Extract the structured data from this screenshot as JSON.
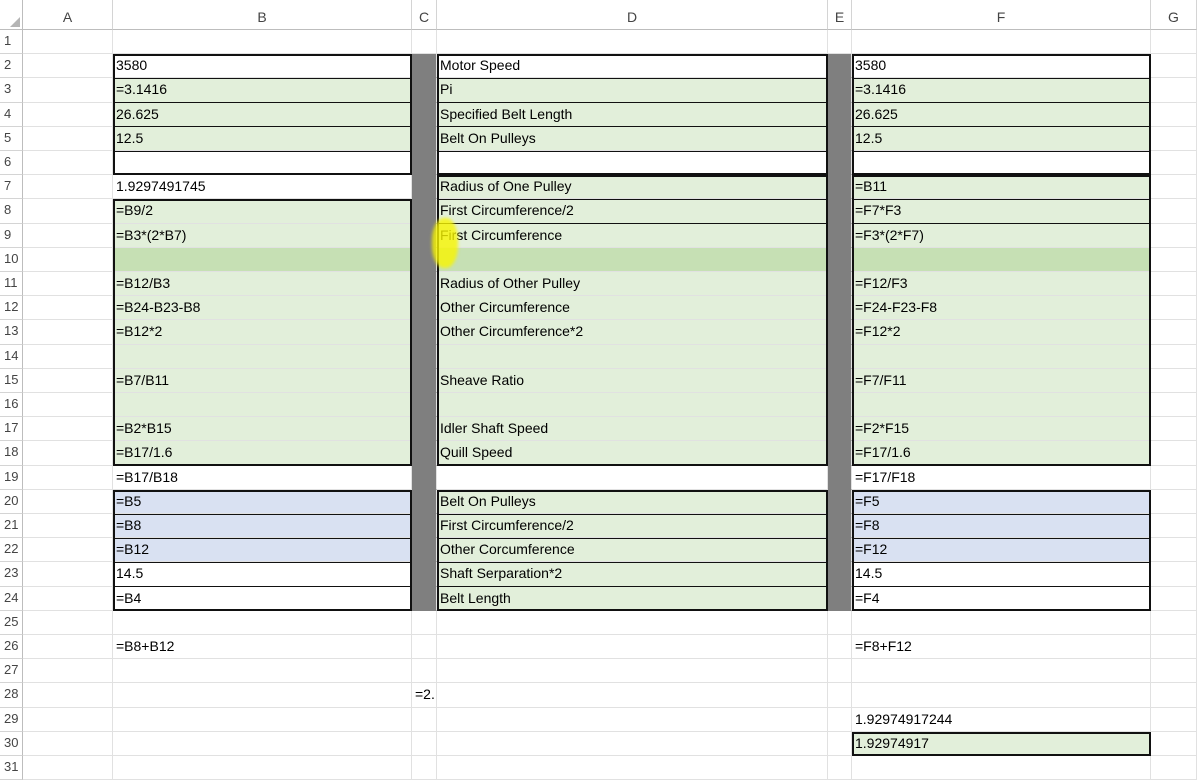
{
  "columns": [
    "A",
    "B",
    "C",
    "D",
    "E",
    "F",
    "G"
  ],
  "rows": [
    "1",
    "2",
    "3",
    "4",
    "5",
    "6",
    "7",
    "8",
    "9",
    "10",
    "11",
    "12",
    "13",
    "14",
    "15",
    "16",
    "17",
    "18",
    "19",
    "20",
    "21",
    "22",
    "23",
    "24",
    "25",
    "26",
    "27",
    "28",
    "29",
    "30",
    "31"
  ],
  "cells": {
    "B2": "3580",
    "D2": "Motor Speed",
    "F2": "3580",
    "B3": "=3.1416",
    "D3": "Pi",
    "F3": "=3.1416",
    "B4": "26.625",
    "D4": "Specified Belt Length",
    "F4": "26.625",
    "B5": "12.5",
    "D5": "Belt On Pulleys",
    "F5": "12.5",
    "B7": "1.9297491745",
    "D7": "Radius of One Pulley",
    "F7": "=B11",
    "B8": "=B9/2",
    "D8": "First Circumference/2",
    "F8": "=F7*F3",
    "B9": "=B3*(2*B7)",
    "D9": "First Circumference",
    "F9": "=F3*(2*F7)",
    "B11": "=B12/B3",
    "D11": "Radius of Other  Pulley",
    "F11": "=F12/F3",
    "B12": "=B24-B23-B8",
    "D12": "Other Circumference",
    "F12": "=F24-F23-F8",
    "B13": "=B12*2",
    "D13": "Other  Circumference*2",
    "F13": "=F12*2",
    "B15": "=B7/B11",
    "D15": "Sheave Ratio",
    "F15": "=F7/F11",
    "B17": "=B2*B15",
    "D17": "Idler Shaft Speed",
    "F17": "=F2*F15",
    "B18": "=B17/1.6",
    "D18": "Quill Speed",
    "F18": "=F17/1.6",
    "B19": "=B17/B18",
    "F19": "=F17/F18",
    "B20": "=B5",
    "D20": "Belt On Pulleys",
    "F20": "=F5",
    "B21": "=B8",
    "D21": "First Circumference/2",
    "F21": "=F8",
    "B22": "=B12",
    "D22": "Other Corcumference",
    "F22": "=F12",
    "B23": "14.5",
    "D23": "Shaft Serparation*2",
    "F23": "14.5",
    "B24": "=B4",
    "D24": "Belt Length",
    "F24": "=F4",
    "B26": "=B8+B12",
    "F26": "=F8+F12",
    "C28": "=2.",
    "F29": "1.92974917244",
    "F30": "1.92974917"
  },
  "fills": {
    "green": "#e2efda",
    "green_dark": "#c6e0b4",
    "blue": "#d9e1f2",
    "gray": "#7f7f7f",
    "white": "#ffffff"
  }
}
